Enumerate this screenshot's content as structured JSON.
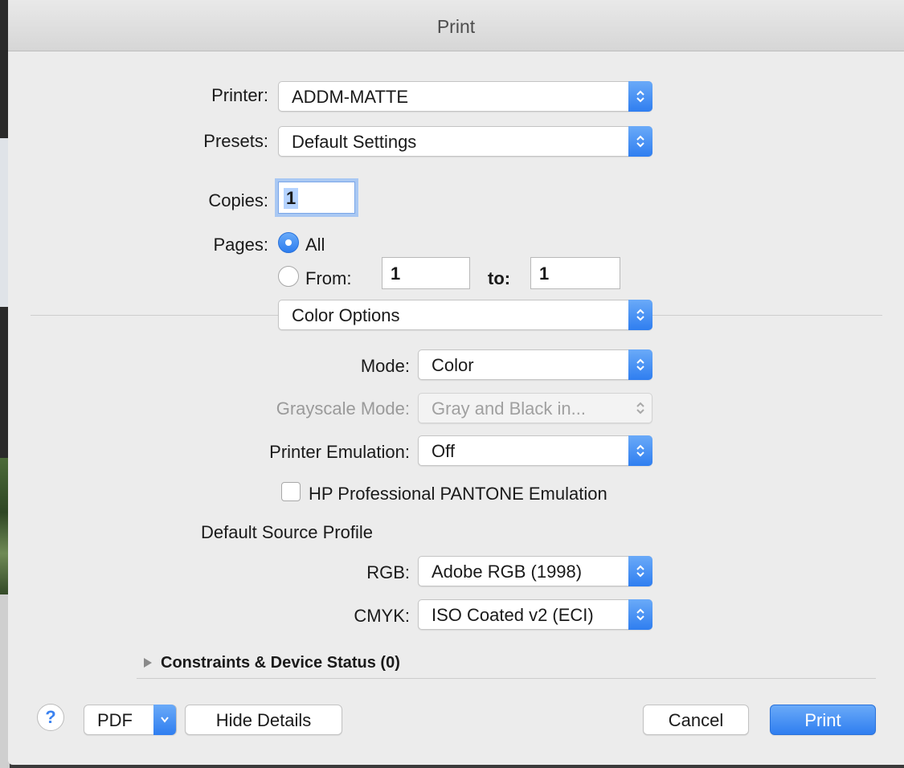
{
  "window": {
    "title": "Print"
  },
  "printer": {
    "label": "Printer:",
    "value": "ADDM-MATTE"
  },
  "presets": {
    "label": "Presets:",
    "value": "Default Settings"
  },
  "copies": {
    "label": "Copies:",
    "value": "1"
  },
  "pages": {
    "label": "Pages:",
    "all_label": "All",
    "from_label": "From:",
    "from_value": "1",
    "to_label": "to:",
    "to_value": "1",
    "selected": "All"
  },
  "section_popup": {
    "value": "Color Options"
  },
  "color_options": {
    "mode": {
      "label": "Mode:",
      "value": "Color"
    },
    "grayscale_mode": {
      "label": "Grayscale Mode:",
      "value": "Gray and Black in...",
      "enabled": false
    },
    "printer_emulation": {
      "label": "Printer Emulation:",
      "value": "Off"
    },
    "pantone_checkbox": {
      "label": "HP Professional PANTONE Emulation",
      "checked": false
    },
    "default_source_profile": {
      "heading": "Default Source Profile"
    },
    "rgb": {
      "label": "RGB:",
      "value": "Adobe RGB (1998)"
    },
    "cmyk": {
      "label": "CMYK:",
      "value": "ISO Coated v2 (ECI)"
    }
  },
  "constraints": {
    "label": "Constraints & Device Status (0)"
  },
  "footer": {
    "help_label": "?",
    "pdf_label": "PDF",
    "hide_details_label": "Hide Details",
    "cancel_label": "Cancel",
    "print_label": "Print"
  },
  "icons": {
    "popup_arrows": "up-down-chevron-icon",
    "pdf_menu": "chevron-down-icon",
    "disclosure": "disclosure-triangle-icon",
    "help": "help-icon"
  },
  "colors": {
    "accent": "#3b82f0",
    "dialog_bg": "#ececec"
  }
}
